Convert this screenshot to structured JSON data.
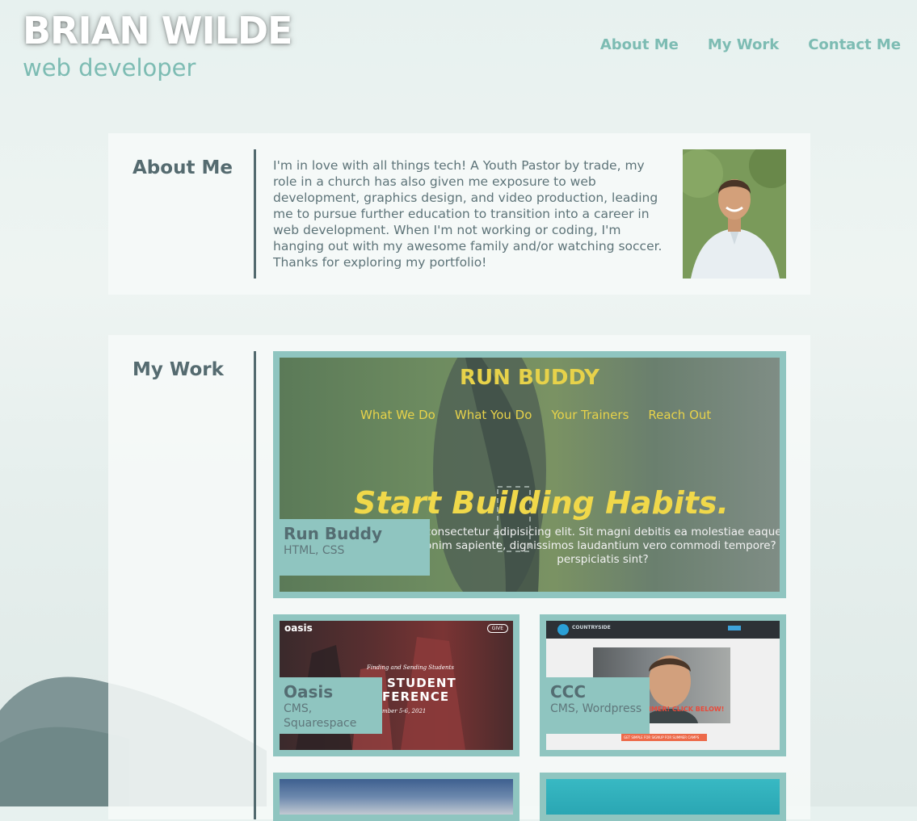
{
  "header": {
    "name": "BRIAN WILDE",
    "subtitle": "web developer",
    "nav": [
      "About Me",
      "My Work",
      "Contact Me"
    ]
  },
  "about": {
    "title": "About Me",
    "text": "I'm in love with all things tech! A Youth Pastor by trade, my role in a church has also given me exposure to web development, graphics design, and video production, leading me to pursue further education to transition into a career in web development. When I'm not working or coding, I'm hanging out with my awesome family and/or watching soccer. Thanks for exploring my portfolio!"
  },
  "work": {
    "title": "My Work",
    "projects": [
      {
        "title": "Run Buddy",
        "tech": "HTML, CSS",
        "screenshot": {
          "brand": "RUN BUDDY",
          "nav": [
            "What We Do",
            "What You Do",
            "Your Trainers",
            "Reach Out"
          ],
          "headline": "Start Building Habits.",
          "body_line1": "consectetur adipisicing elit. Sit magni debitis ea molestiae eaque ab,",
          "body_line2": "onim sapiente, dignissimos laudantium vero commodi tempore? Nam,",
          "body_line3": "perspiciatis sint?"
        }
      },
      {
        "title": "Oasis",
        "tech": "CMS, Squarespace",
        "screenshot": {
          "logo": "oasis",
          "pill": "GIVE",
          "script": "Finding and Sending Students",
          "line1": "STUDENT",
          "line2": "FERENCE",
          "date": "mber 5-6, 2021"
        }
      },
      {
        "title": "CCC",
        "tech": "CMS, Wordpress",
        "screenshot": {
          "logo": "COUNTRYSIDE",
          "banner": "THIS SUMMER! CLICK BELOW!",
          "cta": "GET SIMPLE FOR SIGNUP FOR SUMMER CAMPS"
        }
      }
    ]
  },
  "colors": {
    "accent": "#7dbcb3",
    "frame": "#8fc5c0",
    "heading": "#556b70",
    "body_text": "#5d7378"
  }
}
